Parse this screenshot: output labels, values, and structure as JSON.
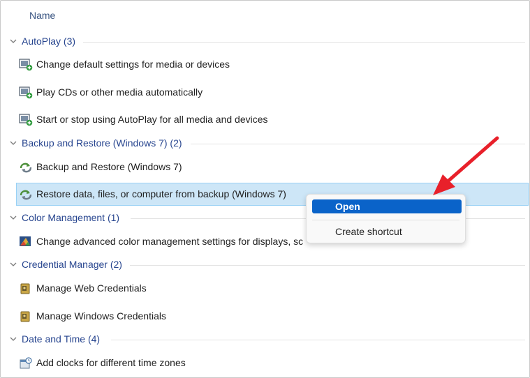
{
  "header": {
    "name_label": "Name"
  },
  "groups": [
    {
      "title": "AutoPlay (3)",
      "items": [
        {
          "label": "Change default settings for media or devices",
          "icon": "autoplay-icon"
        },
        {
          "label": "Play CDs or other media automatically",
          "icon": "autoplay-icon"
        },
        {
          "label": "Start or stop using AutoPlay for all media and devices",
          "icon": "autoplay-icon"
        }
      ]
    },
    {
      "title": "Backup and Restore (Windows 7) (2)",
      "items": [
        {
          "label": "Backup and Restore (Windows 7)",
          "icon": "backup-restore-icon"
        },
        {
          "label": "Restore data, files, or computer from backup (Windows 7)",
          "icon": "backup-restore-icon",
          "selected": true
        }
      ]
    },
    {
      "title": "Color Management (1)",
      "items": [
        {
          "label": "Change advanced color management settings for displays, sc",
          "icon": "color-management-icon"
        }
      ]
    },
    {
      "title": "Credential Manager (2)",
      "items": [
        {
          "label": "Manage Web Credentials",
          "icon": "credential-manager-icon"
        },
        {
          "label": "Manage Windows Credentials",
          "icon": "credential-manager-icon"
        }
      ]
    },
    {
      "title": "Date and Time (4)",
      "items": [
        {
          "label": "Add clocks for different time zones",
          "icon": "date-time-icon"
        }
      ]
    }
  ],
  "context_menu": {
    "open_label": "Open",
    "create_shortcut_label": "Create shortcut"
  },
  "colors": {
    "group_title": "#27458f",
    "selection_bg": "#cde6f7",
    "menu_highlight": "#0a63c9",
    "annotation_arrow": "#e8202a"
  }
}
